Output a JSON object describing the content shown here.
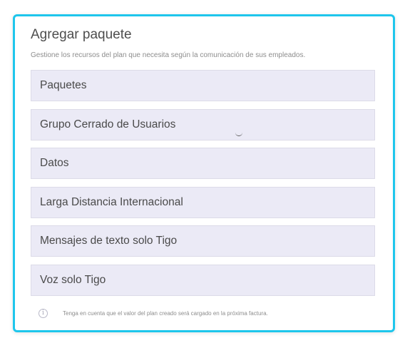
{
  "dialog": {
    "title": "Agregar paquete",
    "subtitle": "Gestione los recursos del plan que necesita según la comunicación de sus empleados."
  },
  "packages": [
    {
      "label": "Paquetes"
    },
    {
      "label": "Grupo Cerrado de Usuarios"
    },
    {
      "label": "Datos"
    },
    {
      "label": "Larga Distancia Internacional"
    },
    {
      "label": "Mensajes de texto solo Tigo"
    },
    {
      "label": "Voz solo Tigo"
    }
  ],
  "note": {
    "icon": "info-icon",
    "text": "Tenga en cuenta que el valor del plan creado será cargado en la próxima factura."
  },
  "colors": {
    "accent_border": "#1ec6ec",
    "item_background": "#ebeaf6"
  }
}
